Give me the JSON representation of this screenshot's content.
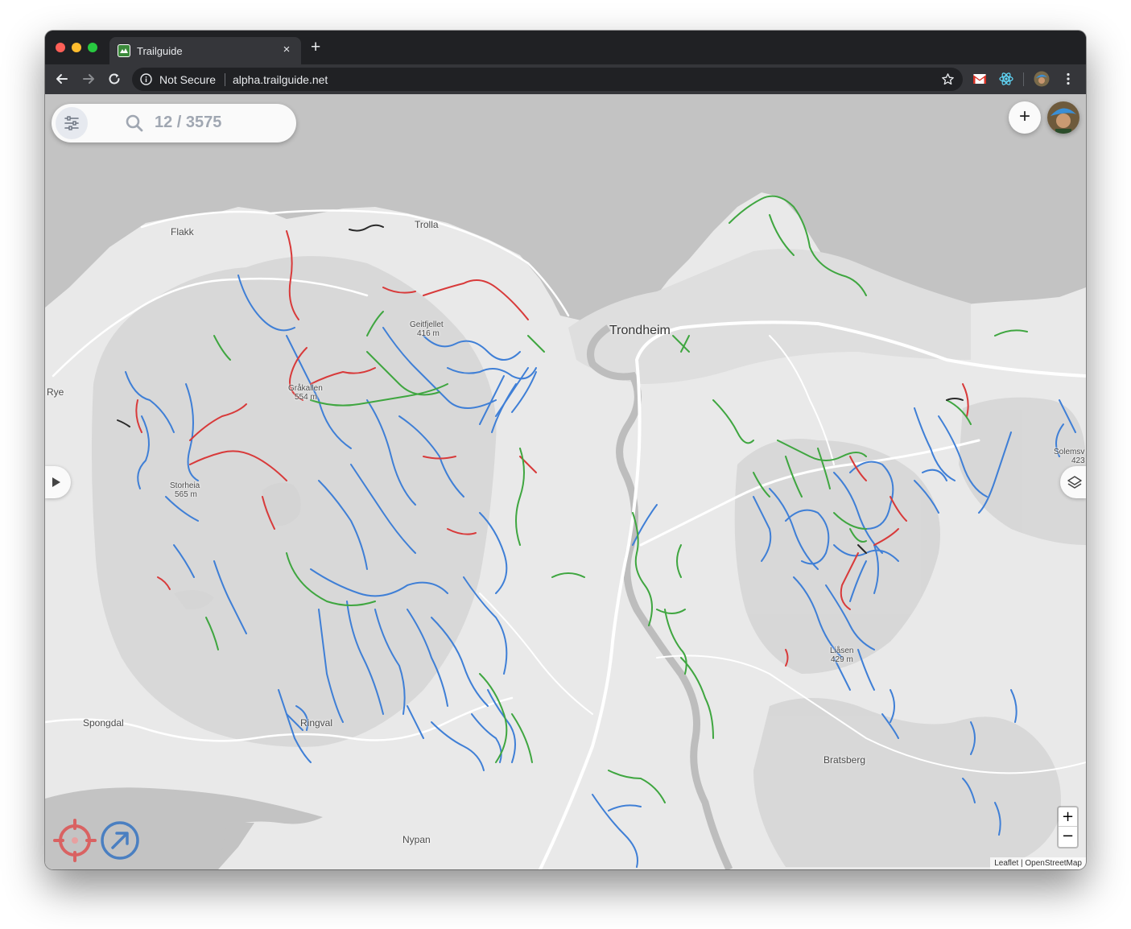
{
  "browser": {
    "tab_title": "Trailguide",
    "new_tab": "+",
    "tab_close": "×",
    "security_label": "Not Secure",
    "url": "alpha.trailguide.net"
  },
  "app": {
    "search": {
      "count_text": "12 / 3575"
    },
    "add_label": "+",
    "zoom_in": "+",
    "zoom_out": "−",
    "attribution_leaflet": "Leaflet",
    "attribution_sep": " | ",
    "attribution_osm": "OpenStreetMap"
  },
  "map": {
    "places": {
      "flakk": "Flakk",
      "trolla": "Trolla",
      "trondheim": "Trondheim",
      "geitfjellet": "Geitfjellet",
      "geitfjellet_elev": "416 m",
      "graakallen": "Gråkallen",
      "graakallen_elev": "554 m",
      "rye": "Rye",
      "storheia": "Storheia",
      "storheia_elev": "565 m",
      "solemsv": "Solemsv",
      "solemsv_elev": "423",
      "laasen": "Liåsen",
      "laasen_elev": "429 m",
      "spongdal": "Spongdal",
      "ringval": "Ringval",
      "bratsberg": "Bratsberg",
      "nypan": "Nypan"
    }
  },
  "colors": {
    "trail_blue": "#3f7fd6",
    "trail_red": "#d83a3a",
    "trail_green": "#3fa640",
    "trail_black": "#2a2a2a",
    "locate_red": "#d96262",
    "follow_blue": "#4a7fc1",
    "water": "#c3c3c3"
  }
}
